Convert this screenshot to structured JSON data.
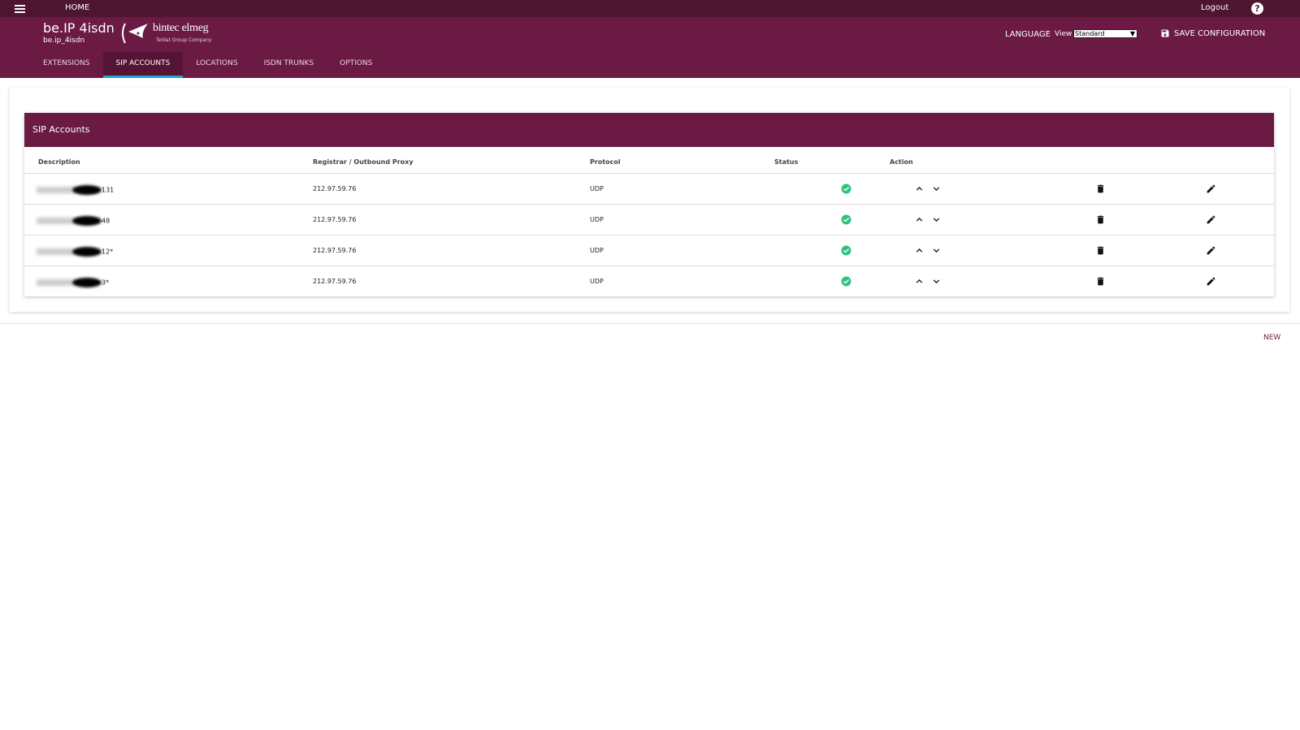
{
  "topbar": {
    "home": "HOME",
    "logout": "Logout",
    "help": "?"
  },
  "header": {
    "title": "be.IP 4isdn",
    "subtitle": "be.ip_4isdn",
    "logo_text": "bintec elmeg",
    "logo_sub": "Teldat Group Company",
    "language": "LANGUAGE",
    "view_label": "View",
    "view_value": "Standard",
    "save": "SAVE CONFIGURATION"
  },
  "tabs": [
    {
      "label": "EXTENSIONS"
    },
    {
      "label": "SIP ACCOUNTS"
    },
    {
      "label": "LOCATIONS"
    },
    {
      "label": "ISDN TRUNKS"
    },
    {
      "label": "OPTIONS"
    }
  ],
  "panel": {
    "title": "SIP Accounts",
    "columns": [
      "Description",
      "Registrar / Outbound Proxy",
      "Protocol",
      "Status",
      "Action"
    ],
    "rows": [
      {
        "desc_suffix": "131",
        "registrar": "212.97.59.76",
        "protocol": "UDP"
      },
      {
        "desc_suffix": "48",
        "registrar": "212.97.59.76",
        "protocol": "UDP"
      },
      {
        "desc_suffix": "12*",
        "registrar": "212.97.59.76",
        "protocol": "UDP"
      },
      {
        "desc_suffix": "3*",
        "registrar": "212.97.59.76",
        "protocol": "UDP"
      }
    ]
  },
  "new_label": "NEW",
  "colors": {
    "brand": "#6b1a44",
    "brand_dark": "#4e1530",
    "tab_active": "#551434",
    "tab_indicator": "#1fa3d6",
    "status_ok": "#2ec27e"
  }
}
